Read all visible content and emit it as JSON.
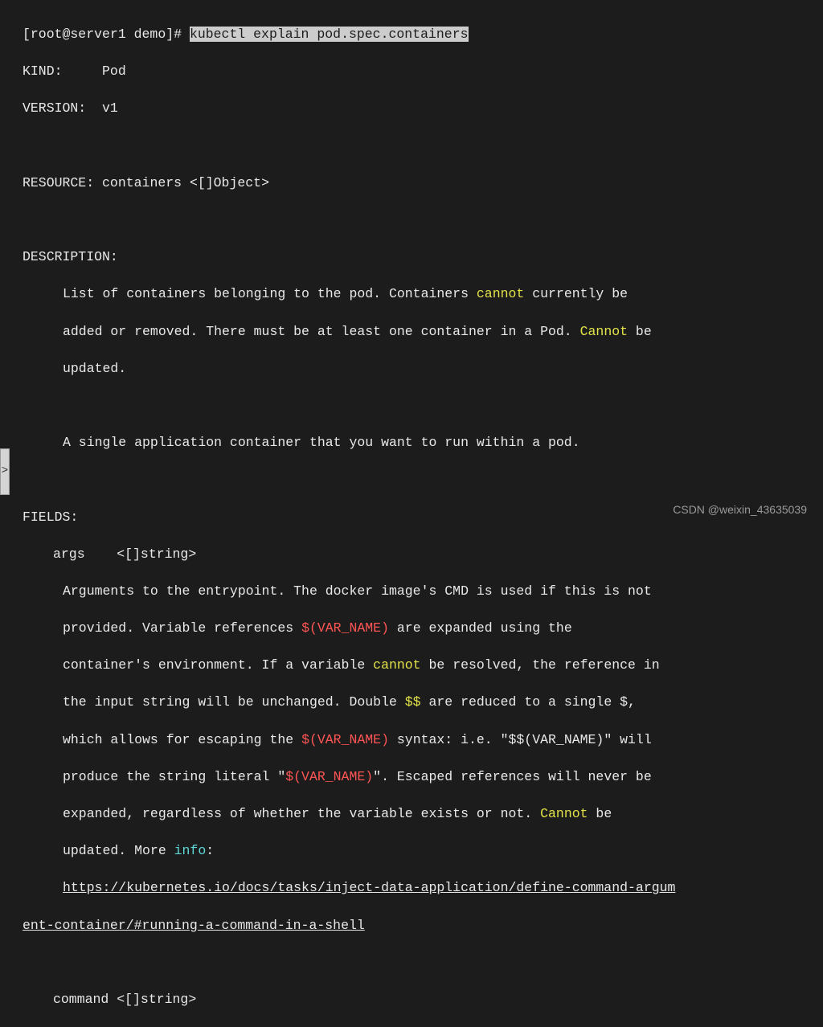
{
  "prompt": {
    "user_host": "[root@server1 demo]# ",
    "command": "kubectl explain pod.spec.containers"
  },
  "header": {
    "kind_label": "KIND:     ",
    "kind_value": "Pod",
    "version_label": "VERSION:  ",
    "version_value": "v1",
    "resource_label": "RESOURCE: ",
    "resource_value": "containers <[]Object>"
  },
  "description": {
    "label": "DESCRIPTION:",
    "line1a": "List of containers belonging to the pod. Containers ",
    "line1_cannot": "cannot",
    "line1b": " currently be",
    "line2a": "added or removed. There must be at least one container in a Pod. ",
    "line2_cannot": "Cannot",
    "line2b": " be",
    "line3": "updated.",
    "line4": "A single application container that you want to run within a pod."
  },
  "fields": {
    "label": "FIELDS:",
    "args_label": "args\t<[]string>",
    "args_desc": {
      "l1": "Arguments to the entrypoint. The docker image's CMD is used if this is not",
      "l2a": "provided. Variable references ",
      "l2_var": "$(VAR_NAME)",
      "l2b": " are expanded using the",
      "l3a": "container's environment. If a variable ",
      "l3_cannot": "cannot",
      "l3b": " be resolved, the reference in",
      "l4a": "the input string will be unchanged. Double ",
      "l4_dd": "$$",
      "l4b": " are reduced to a single $,",
      "l5a": "which allows for escaping the ",
      "l5_var": "$(VAR_NAME)",
      "l5b": " syntax: i.e. \"$$(VAR_NAME)\" will",
      "l6a": "produce the string literal \"",
      "l6_var": "$(VAR_NAME)",
      "l6b": "\". Escaped references will never be",
      "l7a": "expanded, regardless of whether the variable exists or not. ",
      "l7_cannot": "Cannot",
      "l7b": " be",
      "l8a": "updated. More ",
      "l8_info": "info",
      "l8b": ":",
      "url1": "https://kubernetes.io/docs/tasks/inject-data-application/define-command-argum",
      "url2": "ent-container/#running-a-command-in-a-shell"
    },
    "command_label": "command\t<[]string>"
  },
  "watermark": "CSDN @weixin_43635039",
  "side_char": ">"
}
